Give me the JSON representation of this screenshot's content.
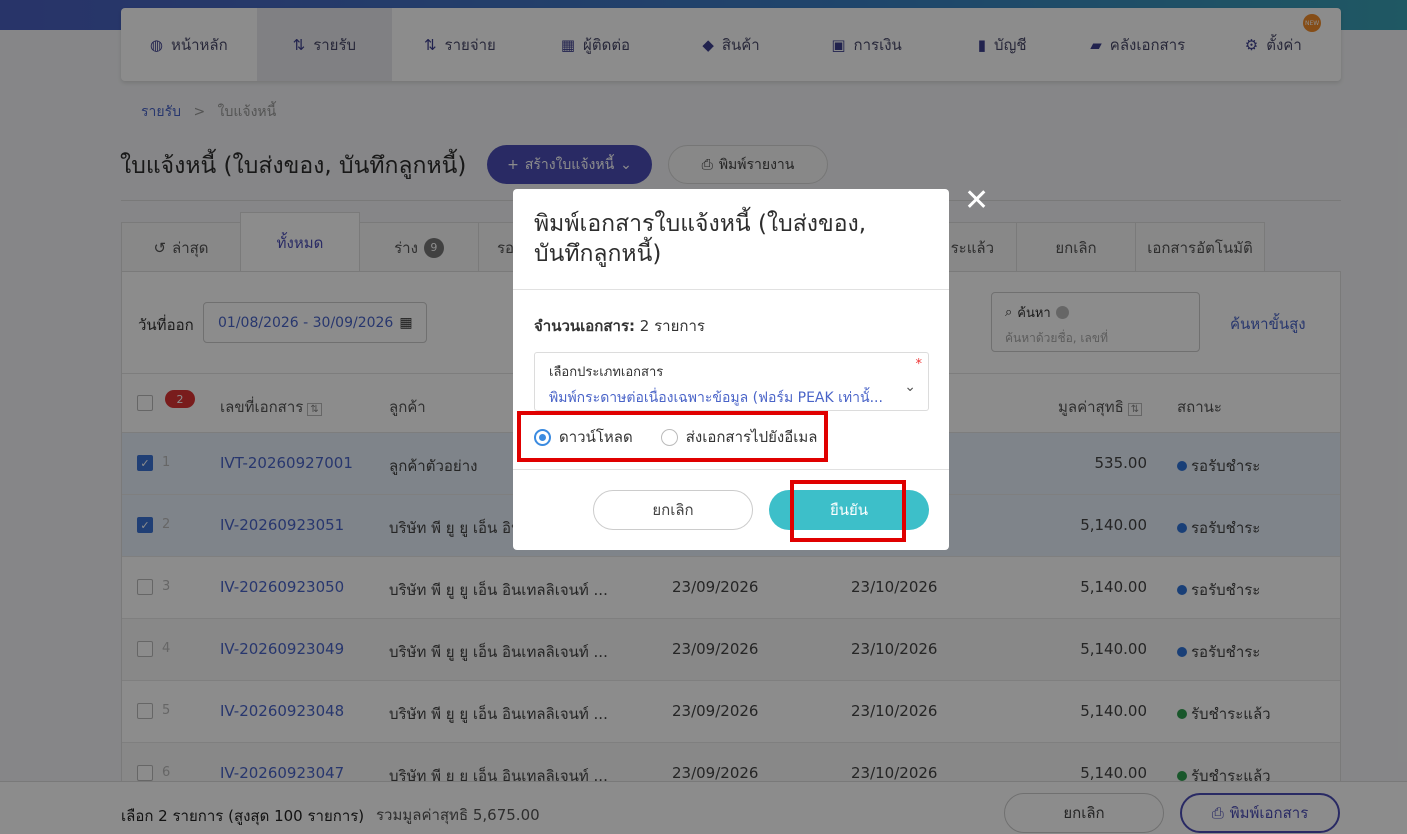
{
  "nav": [
    {
      "label": "หน้าหลัก",
      "icon": "dashboard-icon",
      "glyph": "◍"
    },
    {
      "label": "รายรับ",
      "icon": "income-icon",
      "glyph": "⇅"
    },
    {
      "label": "รายจ่าย",
      "icon": "expense-icon",
      "glyph": "⇅"
    },
    {
      "label": "ผู้ติดต่อ",
      "icon": "contacts-icon",
      "glyph": "▦"
    },
    {
      "label": "สินค้า",
      "icon": "box-icon",
      "glyph": "◆"
    },
    {
      "label": "การเงิน",
      "icon": "money-icon",
      "glyph": "▣"
    },
    {
      "label": "บัญชี",
      "icon": "ledger-icon",
      "glyph": "▮"
    },
    {
      "label": "คลังเอกสาร",
      "icon": "folder-icon",
      "glyph": "▰"
    },
    {
      "label": "ตั้งค่า",
      "icon": "gear-icon",
      "glyph": "⚙"
    }
  ],
  "new_badge": "NEW",
  "breadcrumb": {
    "parent": "รายรับ",
    "sep": ">",
    "current": "ใบแจ้งหนี้"
  },
  "page_title": "ใบแจ้งหนี้ (ใบส่งของ, บันทึกลูกหนี้)",
  "buttons": {
    "create": "สร้างใบแจ้งหนี้",
    "print_report": "พิมพ์รายงาน"
  },
  "tabs": {
    "latest": "ล่าสุด",
    "all": "ทั้งหมด",
    "draft": "ร่าง",
    "draft_count": "9",
    "pending_partial": "รอ",
    "paid_partial": "ระแล้ว",
    "cancelled": "ยกเลิก",
    "auto": "เอกสารอัตโนมัติ"
  },
  "filter": {
    "date_label": "วันที่ออก",
    "date_range": "01/08/2026 - 30/09/2026",
    "search_title": "ค้นหา",
    "search_placeholder": "ค้นหาด้วยชื่อ, เลขที่",
    "advanced": "ค้นหาขั้นสูง"
  },
  "table": {
    "selected_count": "2",
    "headers": {
      "doc_no": "เลขที่เอกสาร",
      "customer": "ลูกค้า",
      "net": "มูลค่าสุทธิ",
      "status": "สถานะ"
    },
    "rows": [
      {
        "idx": "1",
        "doc_no": "IVT-20260927001",
        "customer": "ลูกค้าตัวอย่าง",
        "issue": "",
        "due": "",
        "net": "535.00",
        "status": "รอรับชำระ",
        "status_color": "#2f73d9",
        "checked": true
      },
      {
        "idx": "2",
        "doc_no": "IV-20260923051",
        "customer": "บริษัท พี ยู ยู เอ็น อิน",
        "issue": "",
        "due": "",
        "net": "5,140.00",
        "status": "รอรับชำระ",
        "status_color": "#2f73d9",
        "checked": true
      },
      {
        "idx": "3",
        "doc_no": "IV-20260923050",
        "customer": "บริษัท พี ยู ยู เอ็น อินเทลลิเจนท์ ...",
        "issue": "23/09/2026",
        "due": "23/10/2026",
        "net": "5,140.00",
        "status": "รอรับชำระ",
        "status_color": "#2f73d9",
        "checked": false
      },
      {
        "idx": "4",
        "doc_no": "IV-20260923049",
        "customer": "บริษัท พี ยู ยู เอ็น อินเทลลิเจนท์ ...",
        "issue": "23/09/2026",
        "due": "23/10/2026",
        "net": "5,140.00",
        "status": "รอรับชำระ",
        "status_color": "#2f73d9",
        "checked": false
      },
      {
        "idx": "5",
        "doc_no": "IV-20260923048",
        "customer": "บริษัท พี ยู ยู เอ็น อินเทลลิเจนท์ ...",
        "issue": "23/09/2026",
        "due": "23/10/2026",
        "net": "5,140.00",
        "status": "รับชำระแล้ว",
        "status_color": "#2e9e4f",
        "checked": false
      },
      {
        "idx": "6",
        "doc_no": "IV-20260923047",
        "customer": "บริษัท พี ยู ยู เอ็น อินเทลลิเจนท์ ...",
        "issue": "23/09/2026",
        "due": "23/10/2026",
        "net": "5,140.00",
        "status": "รับชำระแล้ว",
        "status_color": "#2e9e4f",
        "checked": false
      }
    ]
  },
  "footer": {
    "selected": "เลือก 2 รายการ (สูงสุด 100 รายการ)",
    "sum": "รวมมูลค่าสุทธิ 5,675.00",
    "cancel": "ยกเลิก",
    "print": "พิมพ์เอกสาร"
  },
  "modal": {
    "title": "พิมพ์เอกสารใบแจ้งหนี้ (ใบส่งของ, บันทึกลูกหนี้)",
    "count_label": "จำนวนเอกสาร:",
    "count_value": "2 รายการ",
    "select_label": "เลือกประเภทเอกสาร",
    "select_value": "พิมพ์กระดาษต่อเนื่องเฉพาะข้อมูล (ฟอร์ม PEAK เท่านั้...",
    "radio_download": "ดาวน์โหลด",
    "radio_email": "ส่งเอกสารไปยังอีเมล",
    "cancel": "ยกเลิก",
    "confirm": "ยืนยัน"
  }
}
